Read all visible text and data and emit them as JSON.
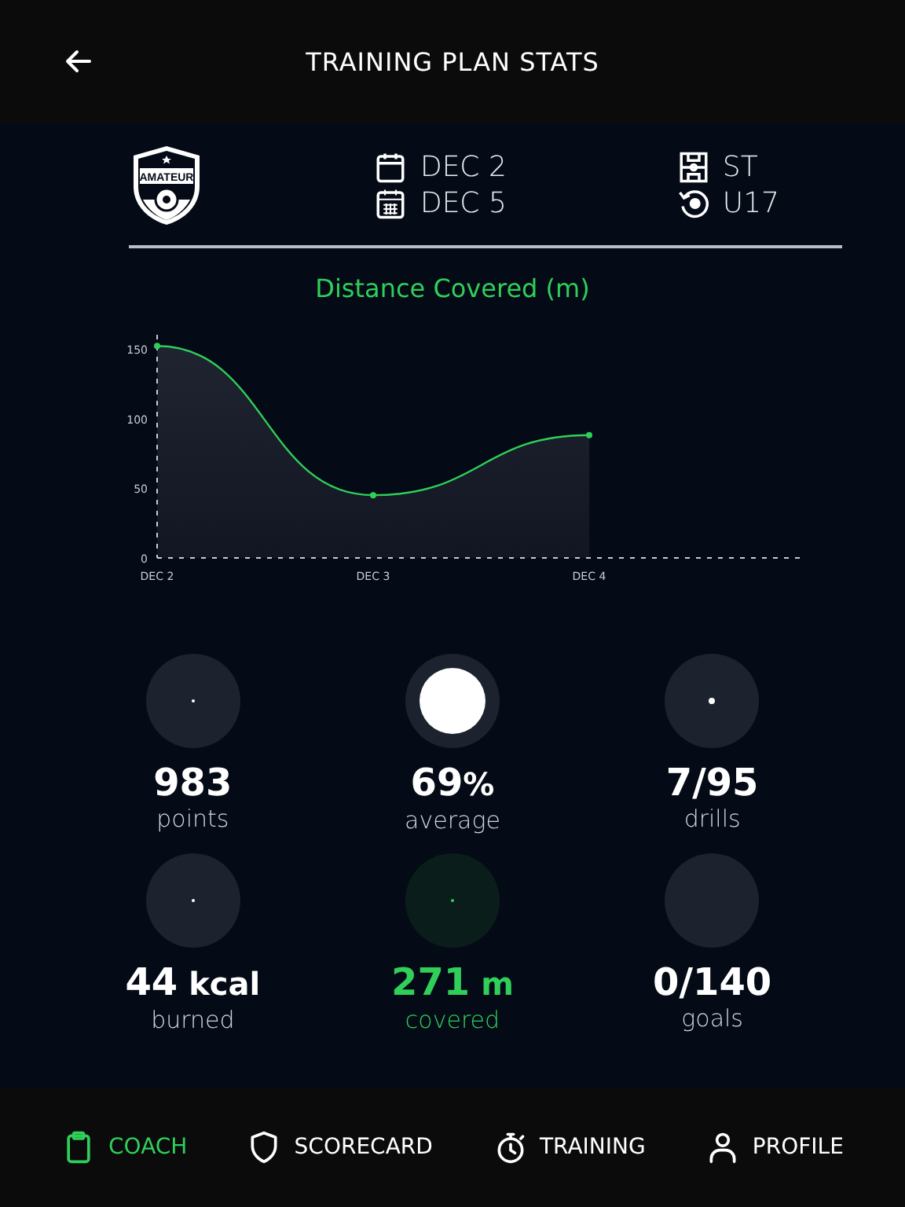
{
  "header": {
    "title": "TRAINING PLAN STATS"
  },
  "info": {
    "badge": "AMATEUR",
    "start_date": "DEC 2",
    "end_date": "DEC 5",
    "position": "ST",
    "age_group": "U17"
  },
  "chart": {
    "title": "Distance Covered (m)",
    "chart_data": {
      "type": "area",
      "categories": [
        "DEC 2",
        "DEC 3",
        "DEC 4"
      ],
      "series": [
        {
          "color": "#2fcf5a",
          "values": [
            152,
            45,
            88
          ]
        }
      ],
      "ylim": [
        0,
        160
      ],
      "yticks": [
        0,
        50,
        100,
        150
      ]
    }
  },
  "stats": [
    {
      "value": "983",
      "label": "points",
      "color": "#ffffff"
    },
    {
      "value": "69",
      "unit": "%",
      "label": "average",
      "color": "#ffffff"
    },
    {
      "value": "7/95",
      "label": "drills",
      "color": "#ffffff"
    },
    {
      "value": "44",
      "unit": "kcal",
      "label": "burned",
      "color": "#ffffff"
    },
    {
      "value": "271",
      "unit": "m",
      "label": "covered",
      "color": "#2fcf5a"
    },
    {
      "value": "0/140",
      "label": "goals",
      "color": "#ffffff"
    }
  ],
  "nav": [
    {
      "label": "COACH",
      "selected": true
    },
    {
      "label": "SCORECARD",
      "selected": false
    },
    {
      "label": "TRAINING",
      "selected": false
    },
    {
      "label": "PROFILE",
      "selected": false
    }
  ]
}
